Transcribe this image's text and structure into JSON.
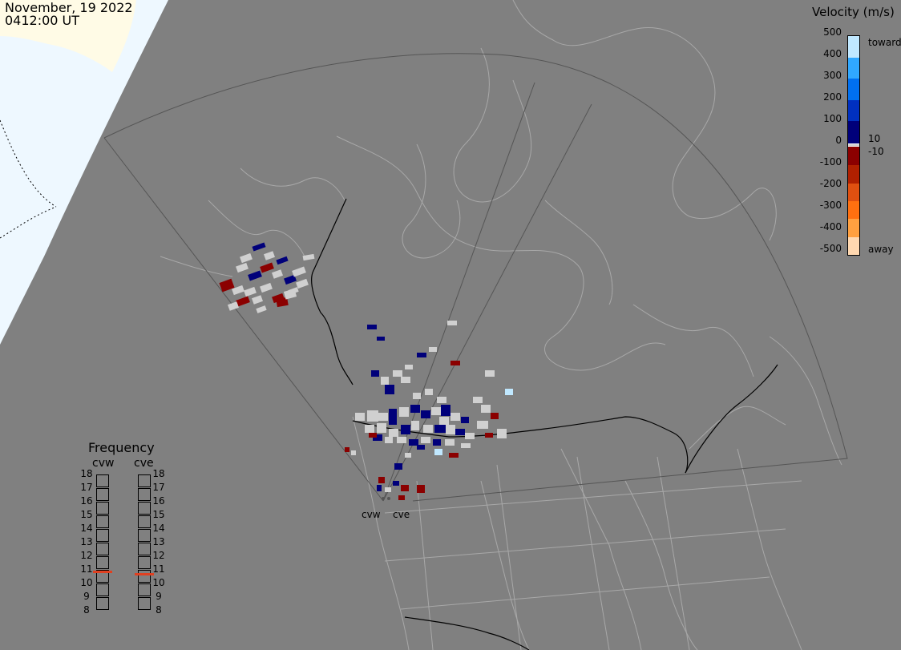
{
  "header": {
    "date": "November, 19 2022",
    "time": "0412:00 UT"
  },
  "legend": {
    "title": "Velocity (m/s)",
    "ticks": [
      "500",
      "400",
      "300",
      "200",
      "100",
      "0",
      "-100",
      "-200",
      "-300",
      "-400",
      "-500"
    ],
    "label_toward": "toward",
    "label_away": "away",
    "label_pos_threshold": "10",
    "label_neg_threshold": "-10",
    "colors": [
      "#ffd8b0",
      "#ffa040",
      "#ff7010",
      "#e05010",
      "#b02000",
      "#8b0000",
      "#d0d0d0",
      "#00007a",
      "#0030c0",
      "#0070f0",
      "#30a8ff",
      "#c0e8ff"
    ]
  },
  "frequency": {
    "title": "Frequency",
    "radars": [
      {
        "name": "cvw",
        "selected_mhz": 10.9
      },
      {
        "name": "cve",
        "selected_mhz": 10.7
      }
    ],
    "scale": [
      "18",
      "17",
      "16",
      "15",
      "14",
      "13",
      "12",
      "11",
      "10",
      "9",
      "8"
    ],
    "marker_color": "#e04020"
  },
  "radar_sites": [
    {
      "name": "cvw"
    },
    {
      "name": "cve"
    }
  ],
  "map": {
    "background_color": "#808080",
    "daylight_color": "#eef8ff",
    "coastline_color": "#a8a8a8",
    "fov_color": "#555555",
    "border_color": "#000000",
    "gs_scatter_color": "#d0d0d0"
  }
}
